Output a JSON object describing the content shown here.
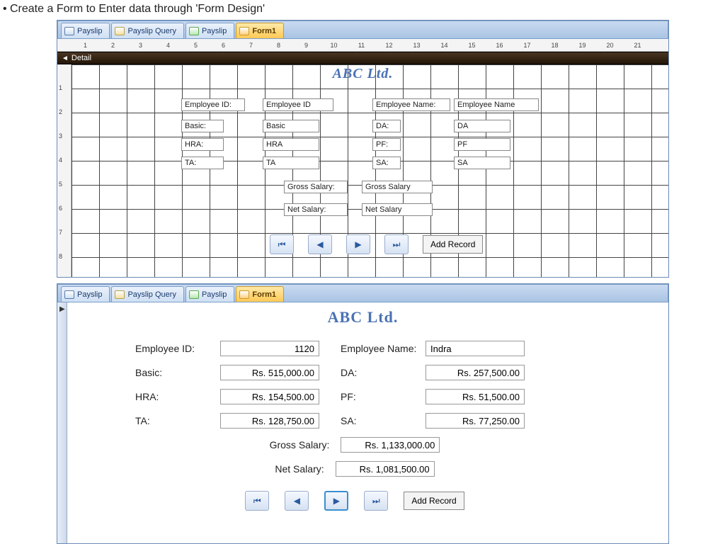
{
  "caption": "Create a Form to Enter data through 'Form Design'",
  "tabs": {
    "payslip_table": "Payslip",
    "payslip_query": "Payslip Query",
    "payslip_form": "Payslip",
    "form1": "Form1"
  },
  "design": {
    "detail_header": "Detail",
    "title": "ABC Ltd.",
    "ruler_marks": [
      "1",
      "2",
      "3",
      "4",
      "5",
      "6",
      "7",
      "8",
      "9",
      "10",
      "11",
      "12",
      "13",
      "14",
      "15",
      "16",
      "17",
      "18",
      "19",
      "20",
      "21"
    ],
    "labels": {
      "emp_id": "Employee ID:",
      "emp_name": "Employee Name:",
      "basic": "Basic:",
      "da": "DA:",
      "hra": "HRA:",
      "pf": "PF:",
      "ta": "TA:",
      "sa": "SA:",
      "gross": "Gross Salary:",
      "net": "Net Salary:"
    },
    "fields": {
      "emp_id": "Employee ID",
      "emp_name": "Employee Name",
      "basic": "Basic",
      "da": "DA",
      "hra": "HRA",
      "pf": "PF",
      "ta": "TA",
      "sa": "SA",
      "gross": "Gross Salary",
      "net": "Net Salary"
    },
    "add_record": "Add Record"
  },
  "run": {
    "title": "ABC Ltd.",
    "labels": {
      "emp_id": "Employee ID:",
      "emp_name": "Employee Name:",
      "basic": "Basic:",
      "da": "DA:",
      "hra": "HRA:",
      "pf": "PF:",
      "ta": "TA:",
      "sa": "SA:",
      "gross": "Gross Salary:",
      "net": "Net Salary:"
    },
    "values": {
      "emp_id": "1120",
      "emp_name": "Indra",
      "basic": "Rs. 515,000.00",
      "da": "Rs. 257,500.00",
      "hra": "Rs. 154,500.00",
      "pf": "Rs. 51,500.00",
      "ta": "Rs. 128,750.00",
      "sa": "Rs. 77,250.00",
      "gross": "Rs. 1,133,000.00",
      "net": "Rs. 1,081,500.00"
    },
    "add_record": "Add Record"
  },
  "nav_glyphs": {
    "first": "⏮",
    "prev": "◀",
    "next": "▶",
    "last": "⏭"
  }
}
